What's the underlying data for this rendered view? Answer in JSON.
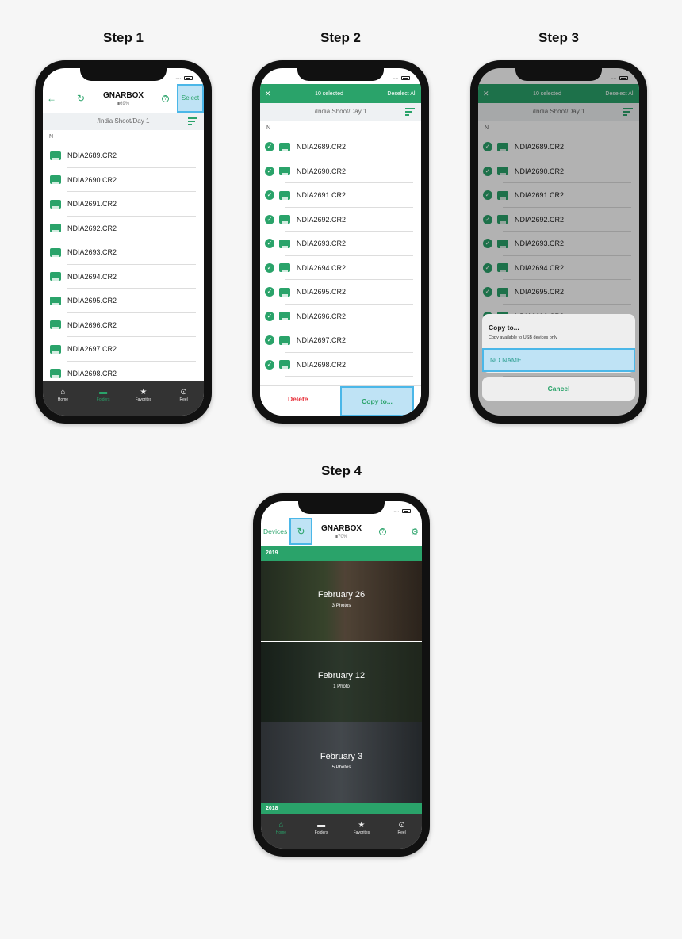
{
  "steps": [
    "Step 1",
    "Step 2",
    "Step 3",
    "Step 4"
  ],
  "colors": {
    "accent": "#2aa36a",
    "highlight": "#bfe3f5",
    "delete": "#e8303a"
  },
  "files": [
    "NDIA2689.CR2",
    "NDIA2690.CR2",
    "NDIA2691.CR2",
    "NDIA2692.CR2",
    "NDIA2693.CR2",
    "NDIA2694.CR2",
    "NDIA2695.CR2",
    "NDIA2696.CR2",
    "NDIA2697.CR2",
    "NDIA2698.CR2"
  ],
  "section": "N",
  "path": "/India Shoot/Day 1",
  "header": {
    "title": "GNARBOX",
    "battery1": "69%",
    "battery4": "70%",
    "select": "Select",
    "devices": "Devices",
    "help_icon": "?"
  },
  "selection": {
    "count": "10 selected",
    "deselect": "Deselect All",
    "delete": "Delete",
    "copy": "Copy to..."
  },
  "dialog": {
    "title": "Copy to...",
    "subtitle": "Copy available to USB devices only",
    "option": "NO NAME",
    "cancel": "Cancel"
  },
  "tabs": [
    {
      "label": "Home",
      "icon": "home-icon"
    },
    {
      "label": "Folders",
      "icon": "folder-icon"
    },
    {
      "label": "Favorites",
      "icon": "star-icon"
    },
    {
      "label": "Reel",
      "icon": "reel-icon"
    }
  ],
  "years": [
    "2019",
    "2018"
  ],
  "cards": [
    {
      "date": "February 26",
      "count": "3 Photos"
    },
    {
      "date": "February 12",
      "count": "1 Photo"
    },
    {
      "date": "February 3",
      "count": "5 Photos"
    }
  ]
}
